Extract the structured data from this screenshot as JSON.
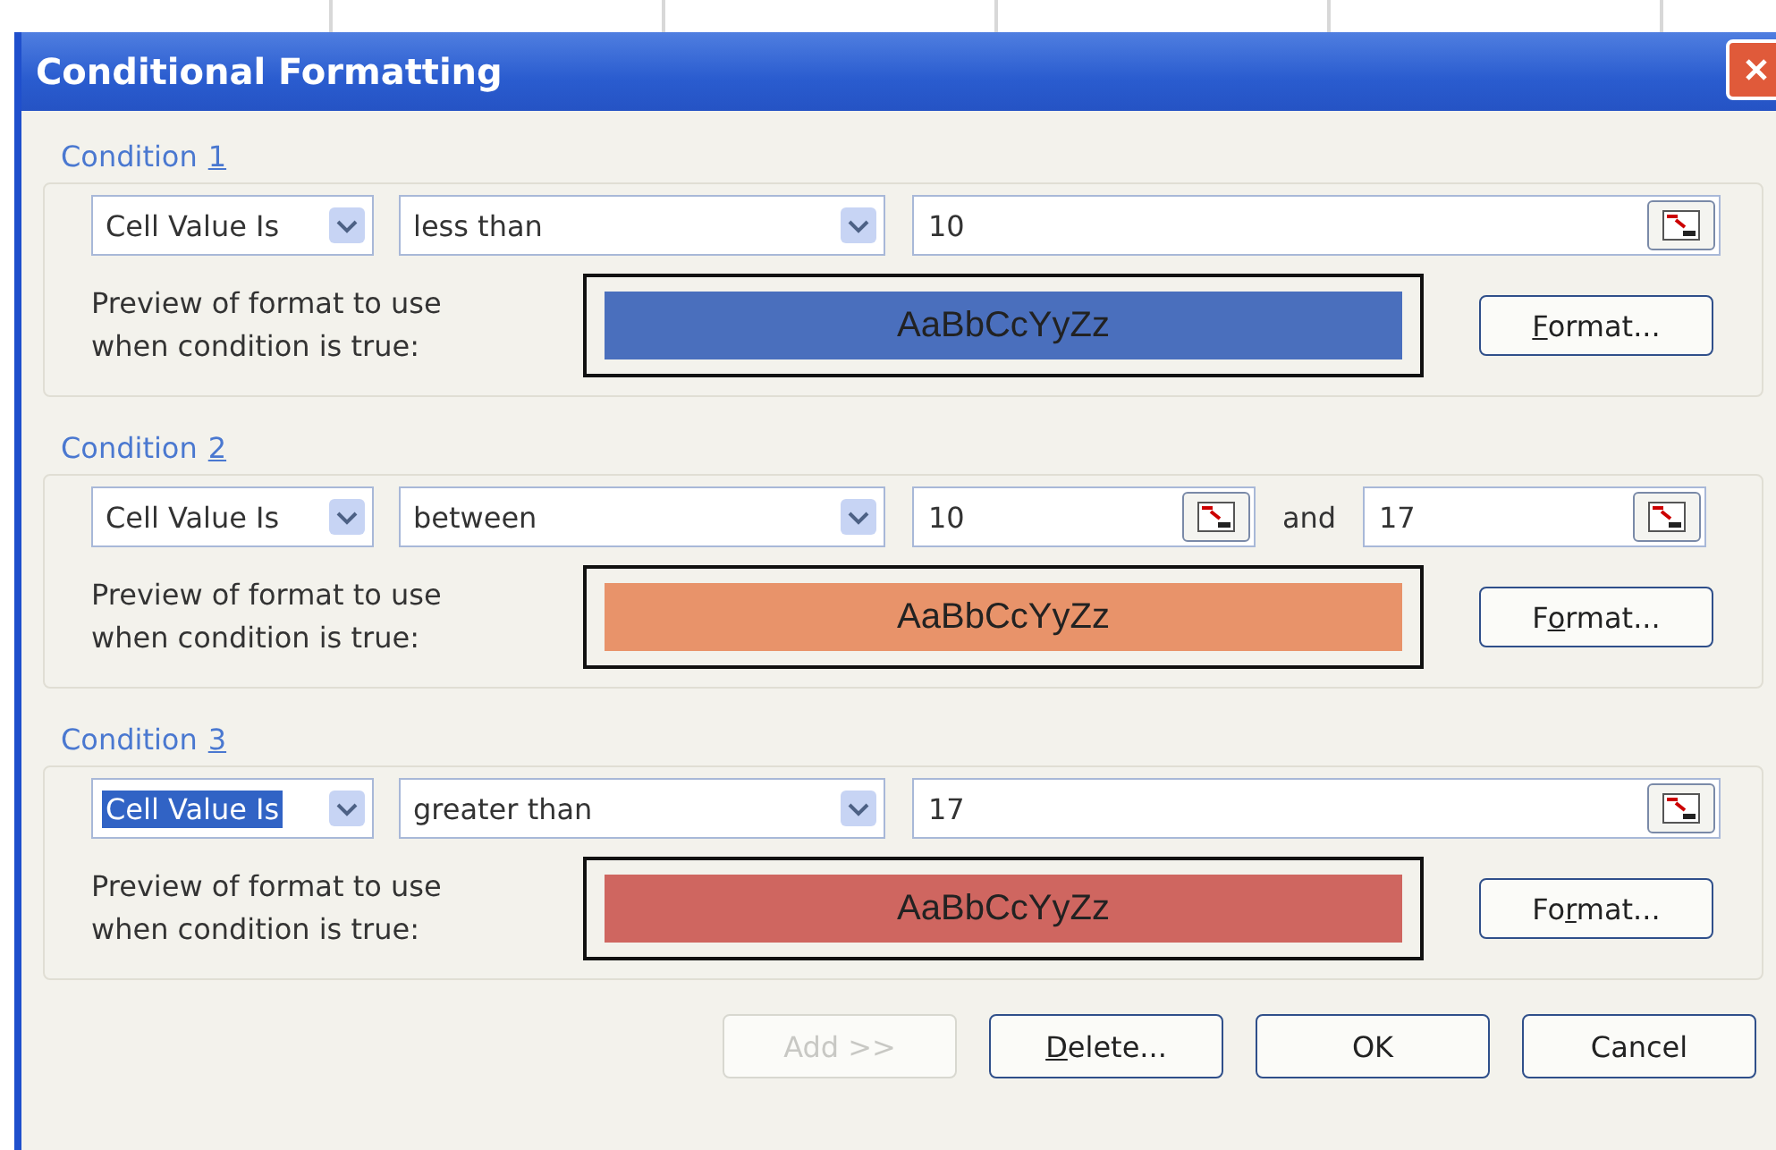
{
  "window": {
    "title": "Conditional Formatting"
  },
  "conditions": [
    {
      "label": "Condition",
      "number": "1",
      "type": "Cell Value Is",
      "type_highlighted": false,
      "operator": "less than",
      "kind": "single",
      "values": [
        "10"
      ],
      "preview_label": "Preview of format to use when condition is true:",
      "preview_text": "AaBbCcYyZz",
      "color": "#4a6fbd",
      "format_button": {
        "key": "F",
        "post": "ormat..."
      }
    },
    {
      "label": "Condition",
      "number": "2",
      "type": "Cell Value Is",
      "type_highlighted": false,
      "operator": "between",
      "kind": "between",
      "values": [
        "10",
        "17"
      ],
      "joiner": "and",
      "preview_label": "Preview of format to use when condition is true:",
      "preview_text": "AaBbCcYyZz",
      "color": "#e8936a",
      "format_button": {
        "pre": "F",
        "key": "o",
        "post": "rmat..."
      }
    },
    {
      "label": "Condition",
      "number": "3",
      "type": "Cell Value Is",
      "type_highlighted": true,
      "operator": "greater than",
      "kind": "single",
      "values": [
        "17"
      ],
      "preview_label": "Preview of format to use when condition is true:",
      "preview_text": "AaBbCcYyZz",
      "color": "#cf6660",
      "format_button": {
        "pre": "Fo",
        "key": "r",
        "post": "mat..."
      }
    }
  ],
  "buttons": [
    {
      "pre": "Add >>",
      "disabled": true
    },
    {
      "key": "D",
      "post": "elete...",
      "disabled": false
    },
    {
      "pre": "OK",
      "disabled": false
    },
    {
      "pre": "Cancel",
      "disabled": false
    }
  ]
}
